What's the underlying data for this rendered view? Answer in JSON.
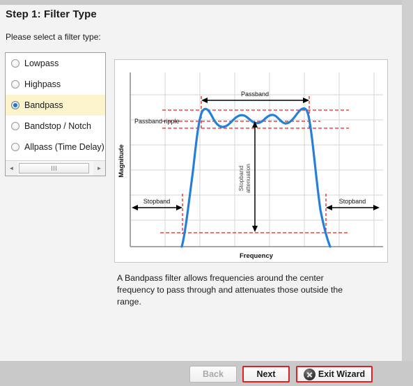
{
  "window": {
    "title": "Step 1: Filter Type",
    "subtitle": "Please select a filter type:"
  },
  "filter_list": {
    "items": [
      {
        "label": "Lowpass",
        "selected": false
      },
      {
        "label": "Highpass",
        "selected": false
      },
      {
        "label": "Bandpass",
        "selected": true
      },
      {
        "label": "Bandstop / Notch",
        "selected": false
      },
      {
        "label": "Allpass (Time Delay)",
        "selected": false
      }
    ],
    "scrollbar": {
      "left_arrow": "◄",
      "right_arrow": "►"
    }
  },
  "description": "A Bandpass filter allows frequencies around the center frequency to pass through and attenuates those outside the range.",
  "footer": {
    "back_label": "Back",
    "back_disabled": true,
    "next_label": "Next",
    "exit_label": "Exit Wizard",
    "exit_icon": "close-circle-icon",
    "focus_color": "#e02020"
  },
  "chart_data": {
    "type": "line",
    "title": "",
    "xlabel": "Frequency",
    "ylabel": "Magnitude",
    "grid": true,
    "axis_ticks": false,
    "series": [
      {
        "name": "Bandpass magnitude response",
        "color": "#2680d8",
        "points": [
          [
            0.155,
            0.0
          ],
          [
            0.17,
            0.1
          ],
          [
            0.185,
            0.3
          ],
          [
            0.2,
            0.56
          ],
          [
            0.215,
            0.74
          ],
          [
            0.228,
            0.84
          ],
          [
            0.24,
            0.88
          ],
          [
            0.252,
            0.875
          ],
          [
            0.268,
            0.845
          ],
          [
            0.285,
            0.815
          ],
          [
            0.3,
            0.8
          ],
          [
            0.32,
            0.805
          ],
          [
            0.345,
            0.825
          ],
          [
            0.37,
            0.845
          ],
          [
            0.395,
            0.845
          ],
          [
            0.42,
            0.832
          ],
          [
            0.445,
            0.822
          ],
          [
            0.47,
            0.822
          ],
          [
            0.495,
            0.834
          ],
          [
            0.52,
            0.848
          ],
          [
            0.545,
            0.848
          ],
          [
            0.57,
            0.834
          ],
          [
            0.595,
            0.82
          ],
          [
            0.62,
            0.812
          ],
          [
            0.645,
            0.822
          ],
          [
            0.665,
            0.845
          ],
          [
            0.685,
            0.858
          ],
          [
            0.705,
            0.855
          ],
          [
            0.722,
            0.835
          ],
          [
            0.738,
            0.81
          ],
          [
            0.752,
            0.8
          ],
          [
            0.768,
            0.812
          ],
          [
            0.785,
            0.845
          ],
          [
            0.8,
            0.872
          ],
          [
            0.812,
            0.882
          ],
          [
            0.824,
            0.865
          ],
          [
            0.838,
            0.8
          ],
          [
            0.852,
            0.68
          ],
          [
            0.868,
            0.5
          ],
          [
            0.884,
            0.3
          ],
          [
            0.898,
            0.13
          ],
          [
            0.91,
            0.0
          ]
        ]
      }
    ],
    "annotations": {
      "passband_label": "Passband",
      "passband_ripple_label": "Passband ripple",
      "stopband_attenuation_label_line1": "Stopband",
      "stopband_attenuation_label_line2": "attenuation",
      "stopband_left_label": "Stopband",
      "stopband_right_label": "Stopband",
      "guide_color": "#ee1c1c",
      "arrow_color": "#000000"
    }
  }
}
